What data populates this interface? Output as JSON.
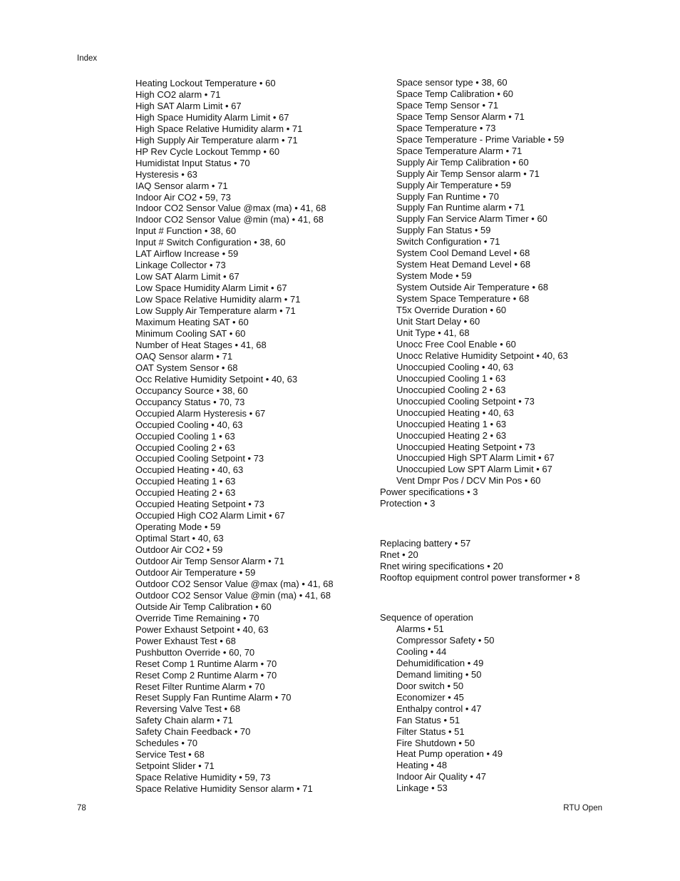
{
  "header": {
    "running_title": "Index"
  },
  "footer": {
    "page_number": "78",
    "doc_title": "RTU Open"
  },
  "left_column": [
    "Heating Lockout Temperature • 60",
    "High CO2 alarm • 71",
    "High SAT Alarm Limit • 67",
    "High Space Humidity Alarm Limit • 67",
    "High Space Relative Humidity alarm • 71",
    "High Supply Air Temperature alarm • 71",
    "HP Rev Cycle Lockout Temmp • 60",
    "Humidistat Input Status • 70",
    "Hysteresis • 63",
    "IAQ Sensor alarm • 71",
    "Indoor Air CO2 • 59, 73",
    "Indoor CO2 Sensor Value @max (ma) • 41, 68",
    "Indoor CO2 Sensor Value @min (ma) • 41, 68",
    "Input # Function • 38, 60",
    "Input # Switch Configuration • 38, 60",
    "LAT Airflow Increase • 59",
    "Linkage Collector • 73",
    "Low SAT Alarm Limit • 67",
    "Low Space Humidity Alarm Limit • 67",
    "Low Space Relative Humidity alarm • 71",
    "Low Supply Air Temperature alarm • 71",
    "Maximum Heating SAT • 60",
    "Minimum Cooling SAT • 60",
    "Number of Heat Stages • 41, 68",
    "OAQ Sensor alarm • 71",
    "OAT System Sensor • 68",
    "Occ Relative Humidity Setpoint • 40, 63",
    "Occupancy Source • 38, 60",
    "Occupancy Status • 70, 73",
    "Occupied Alarm Hysteresis • 67",
    "Occupied Cooling • 40, 63",
    "Occupied Cooling 1 • 63",
    "Occupied Cooling 2 • 63",
    "Occupied Cooling Setpoint • 73",
    "Occupied Heating • 40, 63",
    "Occupied Heating 1 • 63",
    "Occupied Heating 2 • 63",
    "Occupied Heating Setpoint • 73",
    "Occupied High CO2 Alarm Limit • 67",
    "Operating Mode • 59",
    "Optimal Start • 40, 63",
    "Outdoor Air CO2 • 59",
    "Outdoor Air Temp Sensor Alarm • 71",
    "Outdoor Air Temperature • 59",
    "Outdoor CO2 Sensor Value @max (ma) • 41, 68",
    "Outdoor CO2 Sensor Value @min (ma) • 41, 68",
    "Outside Air Temp Calibration • 60",
    "Override Time Remaining • 70",
    "Power Exhaust Setpoint • 40, 63",
    "Power Exhaust Test • 68",
    "Pushbutton Override • 60, 70",
    "Reset Comp 1 Runtime Alarm • 70",
    "Reset Comp 2 Runtime Alarm • 70",
    "Reset Filter Runtime Alarm • 70",
    "Reset Supply Fan Runtime Alarm • 70",
    "Reversing Valve Test • 68",
    "Safety Chain alarm • 71",
    "Safety Chain Feedback • 70",
    "Schedules • 70",
    "Service Test • 68",
    "Setpoint Slider • 71",
    "Space Relative Humidity • 59, 73",
    "Space Relative Humidity Sensor alarm • 71"
  ],
  "right_column": {
    "continued_subentries": [
      "Space sensor type • 38, 60",
      "Space Temp Calibration • 60",
      "Space Temp Sensor • 71",
      "Space Temp Sensor Alarm • 71",
      "Space Temperature • 73",
      "Space Temperature - Prime Variable • 59",
      "Space Temperature Alarm • 71",
      "Supply Air Temp Calibration • 60",
      "Supply Air Temp Sensor alarm • 71",
      "Supply Air Temperature • 59",
      "Supply Fan Runtime • 70",
      "Supply Fan Runtime alarm • 71",
      "Supply Fan Service Alarm Timer • 60",
      "Supply Fan Status • 59",
      "Switch Configuration • 71",
      "System Cool Demand Level • 68",
      "System Heat Demand Level • 68",
      "System Mode • 59",
      "System Outside Air Temperature • 68",
      "System Space Temperature • 68",
      "T5x Override Duration • 60",
      "Unit Start Delay • 60",
      "Unit Type • 41, 68",
      "Unocc Free Cool Enable • 60",
      "Unocc Relative Humidity Setpoint • 40, 63",
      "Unoccupied Cooling • 40, 63",
      "Unoccupied Cooling 1 • 63",
      "Unoccupied Cooling 2 • 63",
      "Unoccupied Cooling Setpoint • 73",
      "Unoccupied Heating • 40, 63",
      "Unoccupied Heating 1 • 63",
      "Unoccupied Heating 2 • 63",
      "Unoccupied Heating Setpoint • 73",
      "Unoccupied High SPT Alarm Limit • 67",
      "Unoccupied Low SPT Alarm Limit • 67",
      "Vent Dmpr Pos / DCV Min Pos • 60"
    ],
    "p_entries": [
      "Power specifications • 3",
      "Protection • 3"
    ],
    "r_entries": [
      "Replacing battery • 57",
      "Rnet • 20",
      "Rnet wiring specifications • 20",
      "Rooftop equipment control power transformer • 8"
    ],
    "s_heading": "Sequence of operation",
    "s_subentries": [
      "Alarms • 51",
      "Compressor Safety • 50",
      "Cooling • 44",
      "Dehumidification • 49",
      "Demand limiting • 50",
      "Door switch • 50",
      "Economizer • 45",
      "Enthalpy control • 47",
      "Fan Status • 51",
      "Filter Status • 51",
      "Fire Shutdown • 50",
      "Heat Pump operation • 49",
      "Heating • 48",
      "Indoor Air Quality • 47",
      "Linkage • 53"
    ]
  }
}
